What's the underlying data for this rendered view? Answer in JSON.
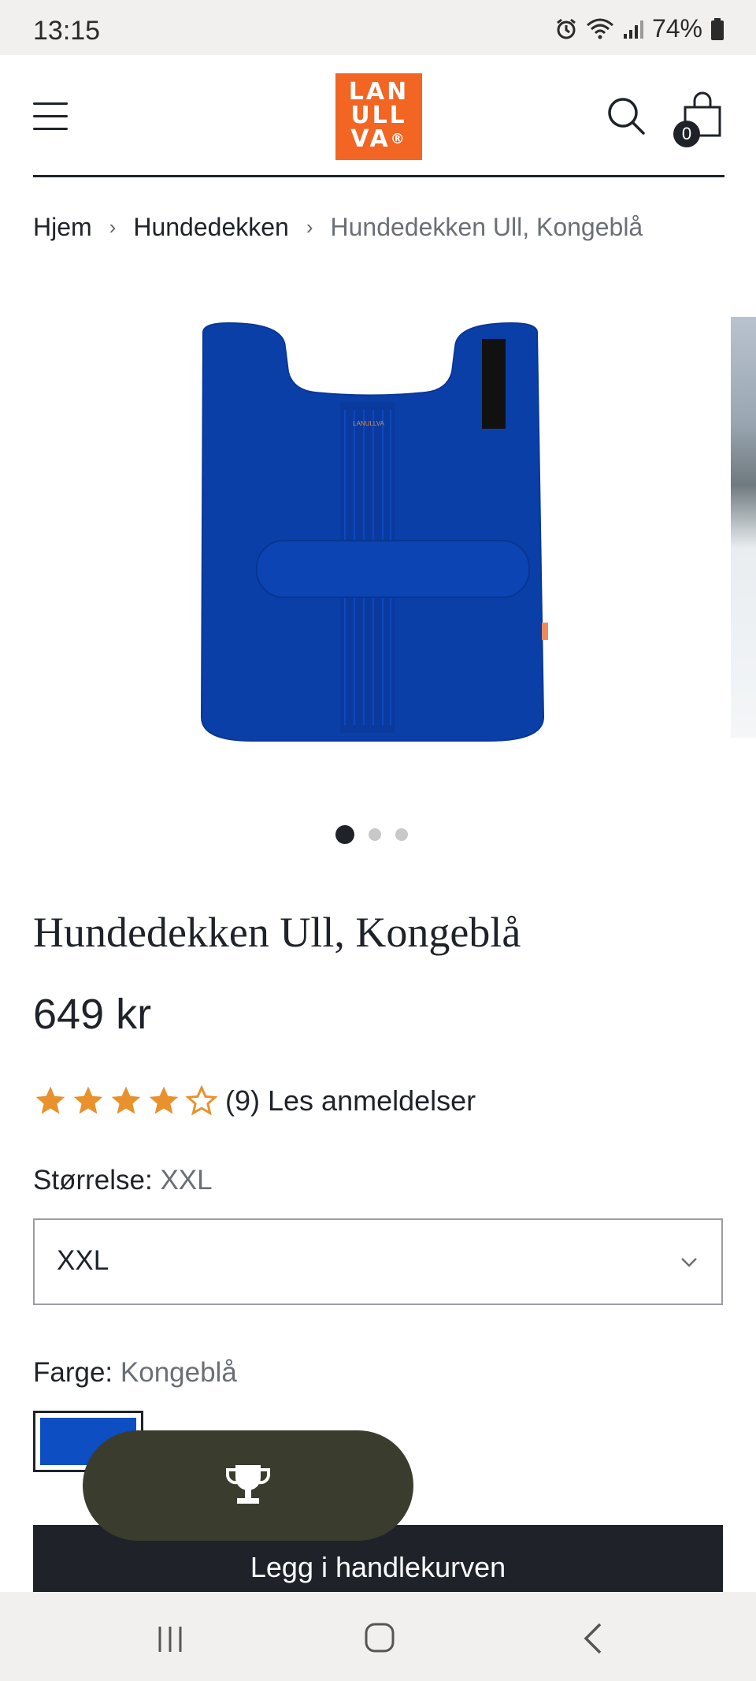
{
  "status_bar": {
    "time": "13:15",
    "battery": "74%"
  },
  "header": {
    "logo_lines": [
      "LAN",
      "ULL",
      "VA"
    ],
    "logo_reg": "®",
    "cart_count": "0"
  },
  "breadcrumb": {
    "items": [
      "Hjem",
      "Hundedekken",
      "Hundedekken Ull, Kongeblå"
    ],
    "separator": "›"
  },
  "gallery": {
    "slide_count": 3,
    "active_slide": 1
  },
  "product": {
    "title": "Hundedekken Ull, Kongeblå",
    "price": "649 kr",
    "rating": {
      "value": 4,
      "max": 5,
      "count_text": "(9) Les anmeldelser"
    },
    "size": {
      "label": "Størrelse:",
      "value": "XXL",
      "selected": "XXL"
    },
    "color": {
      "label": "Farge:",
      "value": "Kongeblå",
      "swatch": "#0d4fc2"
    },
    "add_to_cart": "Legg i handlekurven"
  },
  "colors": {
    "brand": "#f26522",
    "dark": "#1f2329",
    "product_blue": "#0b3fa8",
    "pill": "#3a3d2e"
  }
}
